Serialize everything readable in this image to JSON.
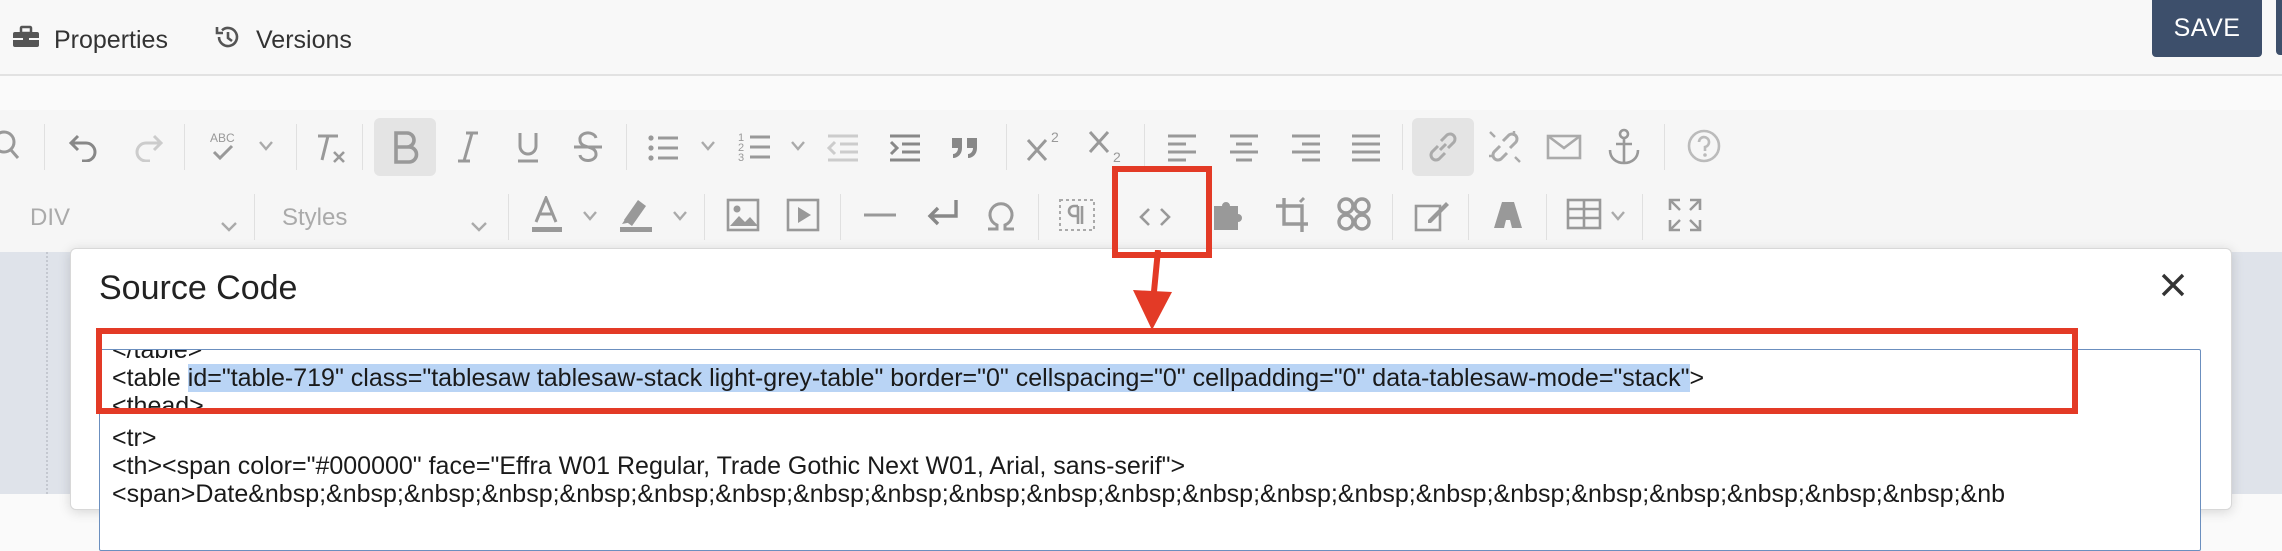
{
  "header": {
    "tabs": [
      {
        "label": "Properties",
        "icon": "toolbox-icon"
      },
      {
        "label": "Versions",
        "icon": "history-icon"
      }
    ],
    "save_label": "SAVE"
  },
  "toolbar": {
    "block_format": "DIV",
    "styles_placeholder": "Styles",
    "spellcheck_label": "ABC"
  },
  "dialog": {
    "title": "Source Code",
    "code_lines": [
      "</table>",
      "<table ",
      "id=\"table-719\" class=\"tablesaw tablesaw-stack light-grey-table\" border=\"0\" cellspacing=\"0\" cellpadding=\"0\" data-tablesaw-mode=\"stack\"",
      ">",
      "<thead>",
      "<tr>",
      "<th><span color=\"#000000\" face=\"Effra W01 Regular, Trade Gothic Next W01, Arial, sans-serif\">",
      "<span>Date&nbsp;&nbsp;&nbsp;&nbsp;&nbsp;&nbsp;&nbsp;&nbsp;&nbsp;&nbsp;&nbsp;&nbsp;&nbsp;&nbsp;&nbsp;&nbsp;&nbsp;&nbsp;&nbsp;&nbsp;&nbsp;&nbsp;&nb"
    ]
  },
  "colors": {
    "save_bg": "#3d4f6b",
    "annotation_red": "#e33a26",
    "selection": "#b9d4f5"
  }
}
